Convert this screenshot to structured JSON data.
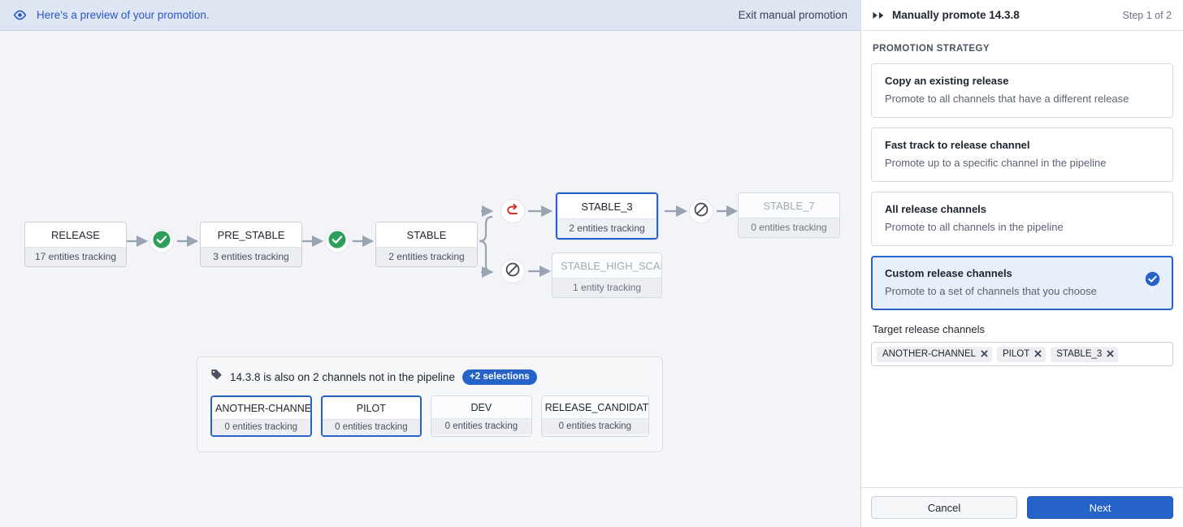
{
  "banner": {
    "icon": "eye-icon",
    "message": "Here's a preview of your promotion.",
    "exit_label": "Exit manual promotion",
    "accent_color": "#2b57c4",
    "background": "#dee5f3"
  },
  "pipeline": {
    "nodes": [
      {
        "id": "release",
        "name": "RELEASE",
        "sub": "17 entities tracking",
        "state": "normal"
      },
      {
        "id": "pre_stable",
        "name": "PRE_STABLE",
        "sub": "3 entities tracking",
        "state": "normal"
      },
      {
        "id": "stable",
        "name": "STABLE",
        "sub": "2 entities tracking",
        "state": "normal"
      },
      {
        "id": "stable_3",
        "name": "STABLE_3",
        "sub": "2 entities tracking",
        "state": "selected"
      },
      {
        "id": "stable_7",
        "name": "STABLE_7",
        "sub": "0 entities tracking",
        "state": "disabled"
      },
      {
        "id": "stable_high_scale",
        "name": "STABLE_HIGH_SCALE",
        "sub": "1 entity tracking",
        "state": "disabled"
      }
    ],
    "gates": [
      {
        "id": "gate-release-prestable",
        "icon": "check-circle-icon",
        "status": "pass"
      },
      {
        "id": "gate-prestable-stable",
        "icon": "check-circle-icon",
        "status": "pass"
      },
      {
        "id": "gate-stable-stable3",
        "icon": "revert-icon",
        "status": "revert"
      },
      {
        "id": "gate-stable3-stable7",
        "icon": "blocked-icon",
        "status": "blocked"
      },
      {
        "id": "gate-stable-highscale",
        "icon": "blocked-icon",
        "status": "blocked"
      }
    ],
    "colors": {
      "pass": "#2e9e5b",
      "revert": "#c9352f",
      "blocked": "#3f4656",
      "selected": "#2563c9"
    }
  },
  "extra_channels": {
    "icon": "tag-icon",
    "message": "14.3.8 is also on 2 channels not in the pipeline",
    "badge": "+2 selections",
    "channels": [
      {
        "name": "ANOTHER-CHANNEL",
        "sub": "0 entities tracking",
        "selected": true
      },
      {
        "name": "PILOT",
        "sub": "0 entities tracking",
        "selected": true
      },
      {
        "name": "DEV",
        "sub": "0 entities tracking",
        "selected": false
      },
      {
        "name": "RELEASE_CANDIDATE",
        "sub": "0 entities tracking",
        "selected": false
      }
    ]
  },
  "panel": {
    "icon": "fast-forward-icon",
    "title": "Manually promote 14.3.8",
    "step": "Step 1 of 2",
    "section_label": "PROMOTION STRATEGY",
    "strategies": [
      {
        "title": "Copy an existing release",
        "desc": "Promote to all channels that have a different release",
        "selected": false
      },
      {
        "title": "Fast track to release channel",
        "desc": "Promote up to a specific channel in the pipeline",
        "selected": false
      },
      {
        "title": "All release channels",
        "desc": "Promote to all channels in the pipeline",
        "selected": false
      },
      {
        "title": "Custom release channels",
        "desc": "Promote to a set of channels that you choose",
        "selected": true
      }
    ],
    "target_field_label": "Target release channels",
    "target_chips": [
      "ANOTHER-CHANNEL",
      "PILOT",
      "STABLE_3"
    ],
    "footer": {
      "cancel_label": "Cancel",
      "next_label": "Next",
      "primary_color": "#2563c9"
    }
  }
}
